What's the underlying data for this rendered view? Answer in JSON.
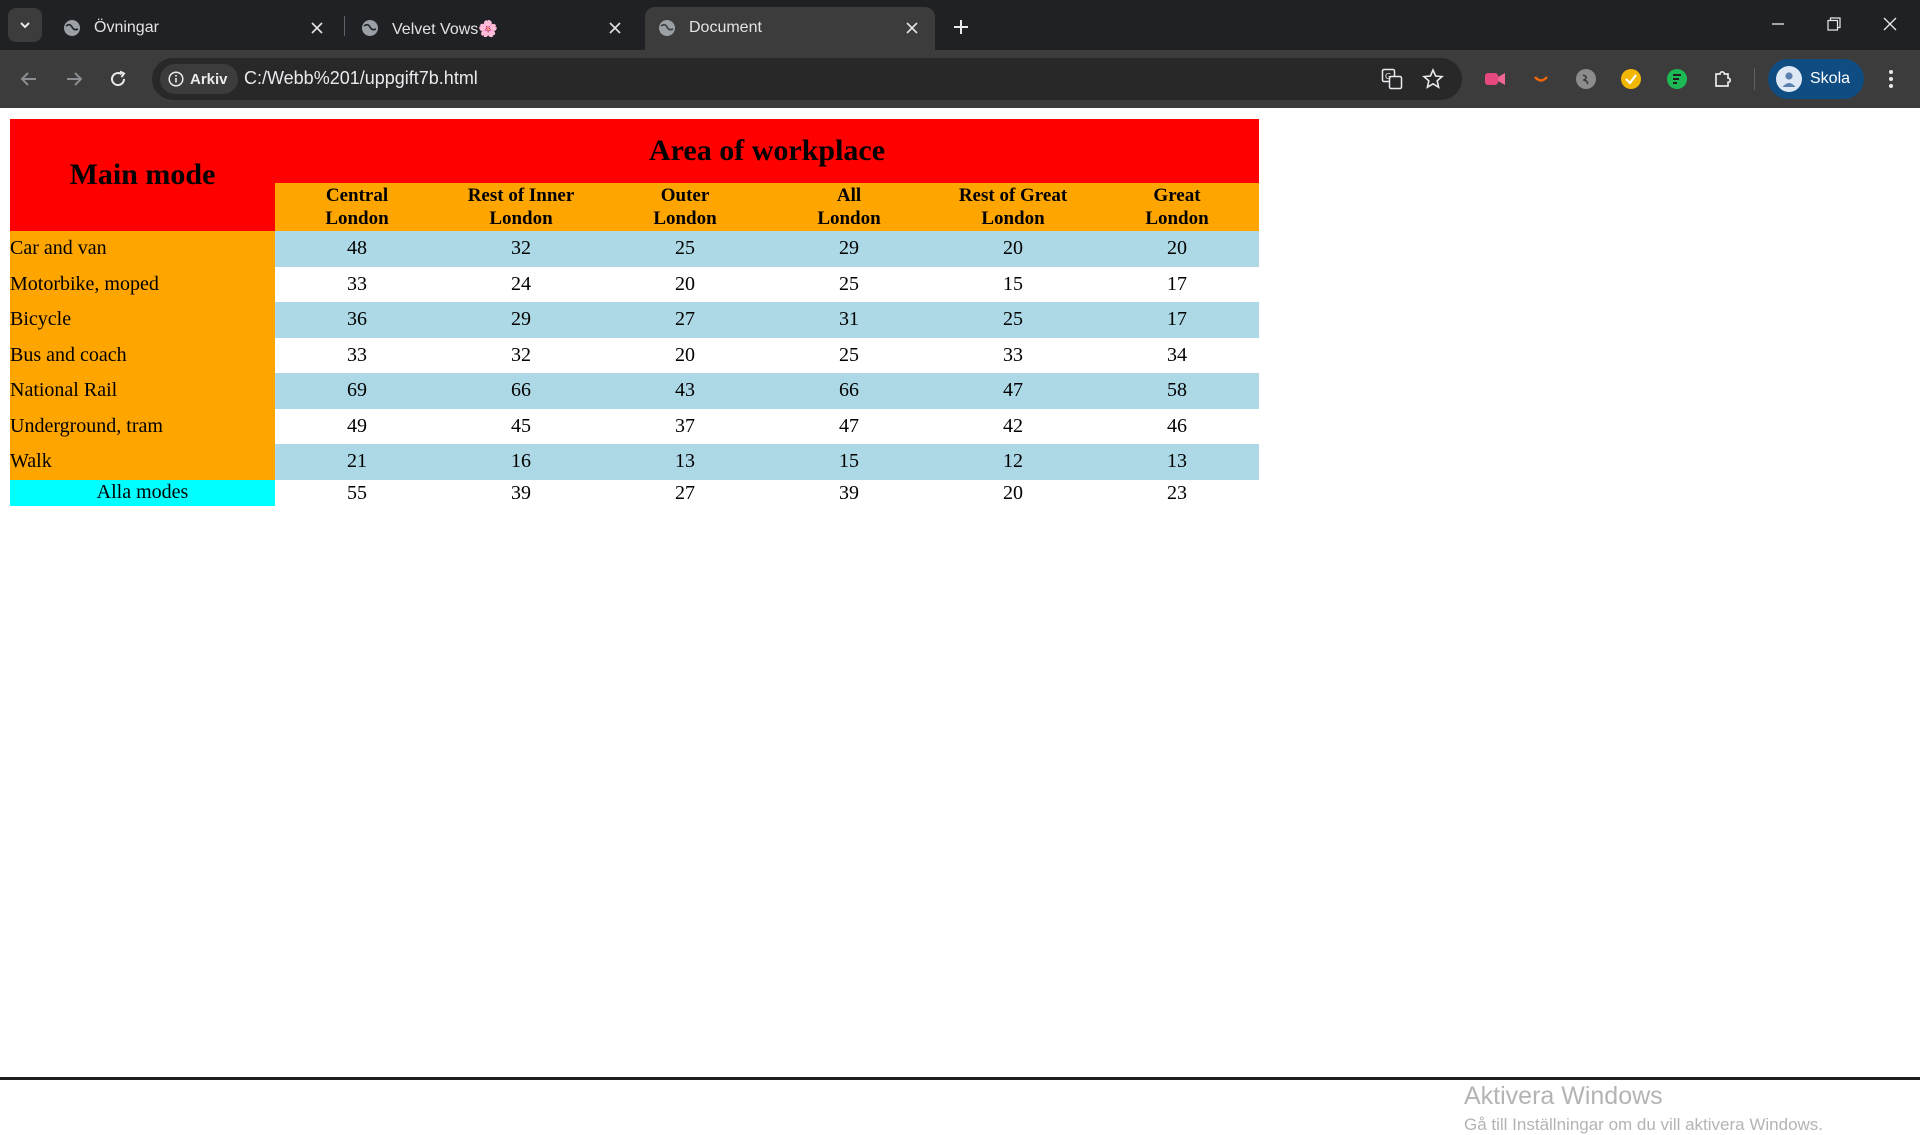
{
  "browser": {
    "tabs": [
      {
        "title": "Övningar",
        "active": false
      },
      {
        "title": "Velvet Vows🌸",
        "active": false
      },
      {
        "title": "Document",
        "active": true
      }
    ],
    "chip_label": "Arkiv",
    "url": "C:/Webb%201/uppgift7b.html",
    "profile_name": "Skola",
    "colors": {
      "tabstrip": "#202124",
      "toolbar": "#3c3c3c",
      "omnibox": "#282828"
    }
  },
  "table": {
    "main_mode_header": "Main mode",
    "area_header": "Area of workplace",
    "columns": [
      {
        "line1": "Central",
        "line2": "London"
      },
      {
        "line1": "Rest of Inner",
        "line2": "London"
      },
      {
        "line1": "Outer",
        "line2": "London"
      },
      {
        "line1": "All",
        "line2": "London"
      },
      {
        "line1": "Rest of Great",
        "line2": "London"
      },
      {
        "line1": "Great",
        "line2": "London"
      }
    ],
    "rows": [
      {
        "label": "Car and van",
        "values": [
          "48",
          "32",
          "25",
          "29",
          "20",
          "20"
        ]
      },
      {
        "label": "Motorbike, moped",
        "values": [
          "33",
          "24",
          "20",
          "25",
          "15",
          "17"
        ]
      },
      {
        "label": "Bicycle",
        "values": [
          "36",
          "29",
          "27",
          "31",
          "25",
          "17"
        ]
      },
      {
        "label": "Bus and coach",
        "values": [
          "33",
          "32",
          "20",
          "25",
          "33",
          "34"
        ]
      },
      {
        "label": "National Rail",
        "values": [
          "69",
          "66",
          "43",
          "66",
          "47",
          "58"
        ]
      },
      {
        "label": "Underground, tram",
        "values": [
          "49",
          "45",
          "37",
          "47",
          "42",
          "46"
        ]
      },
      {
        "label": "Walk",
        "values": [
          "21",
          "16",
          "13",
          "15",
          "12",
          "13"
        ]
      }
    ],
    "total": {
      "label": "Alla modes",
      "values": [
        "55",
        "39",
        "27",
        "39",
        "20",
        "23"
      ]
    },
    "colors": {
      "header": "#ff0000",
      "subheader": "#ffa500",
      "row_alt": "#add8e6",
      "total_label": "#00ffff"
    }
  },
  "watermark": {
    "line1": "Aktivera Windows",
    "line2": "Gå till Inställningar om du vill aktivera Windows."
  }
}
